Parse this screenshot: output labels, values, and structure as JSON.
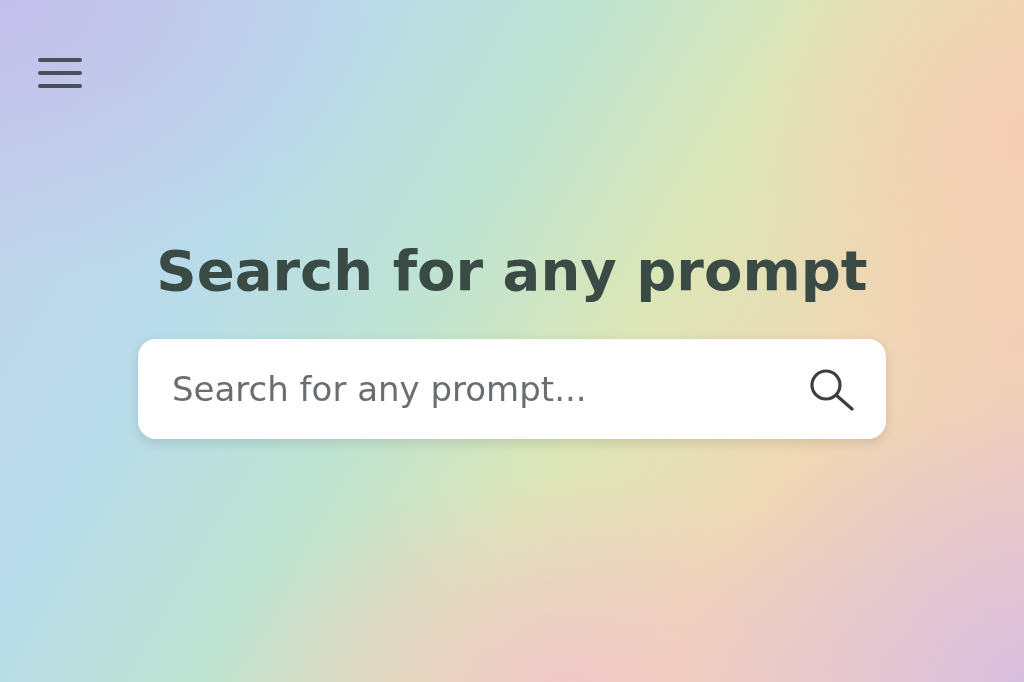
{
  "heading": "Search for any prompt",
  "search": {
    "placeholder": "Search for any prompt..."
  }
}
